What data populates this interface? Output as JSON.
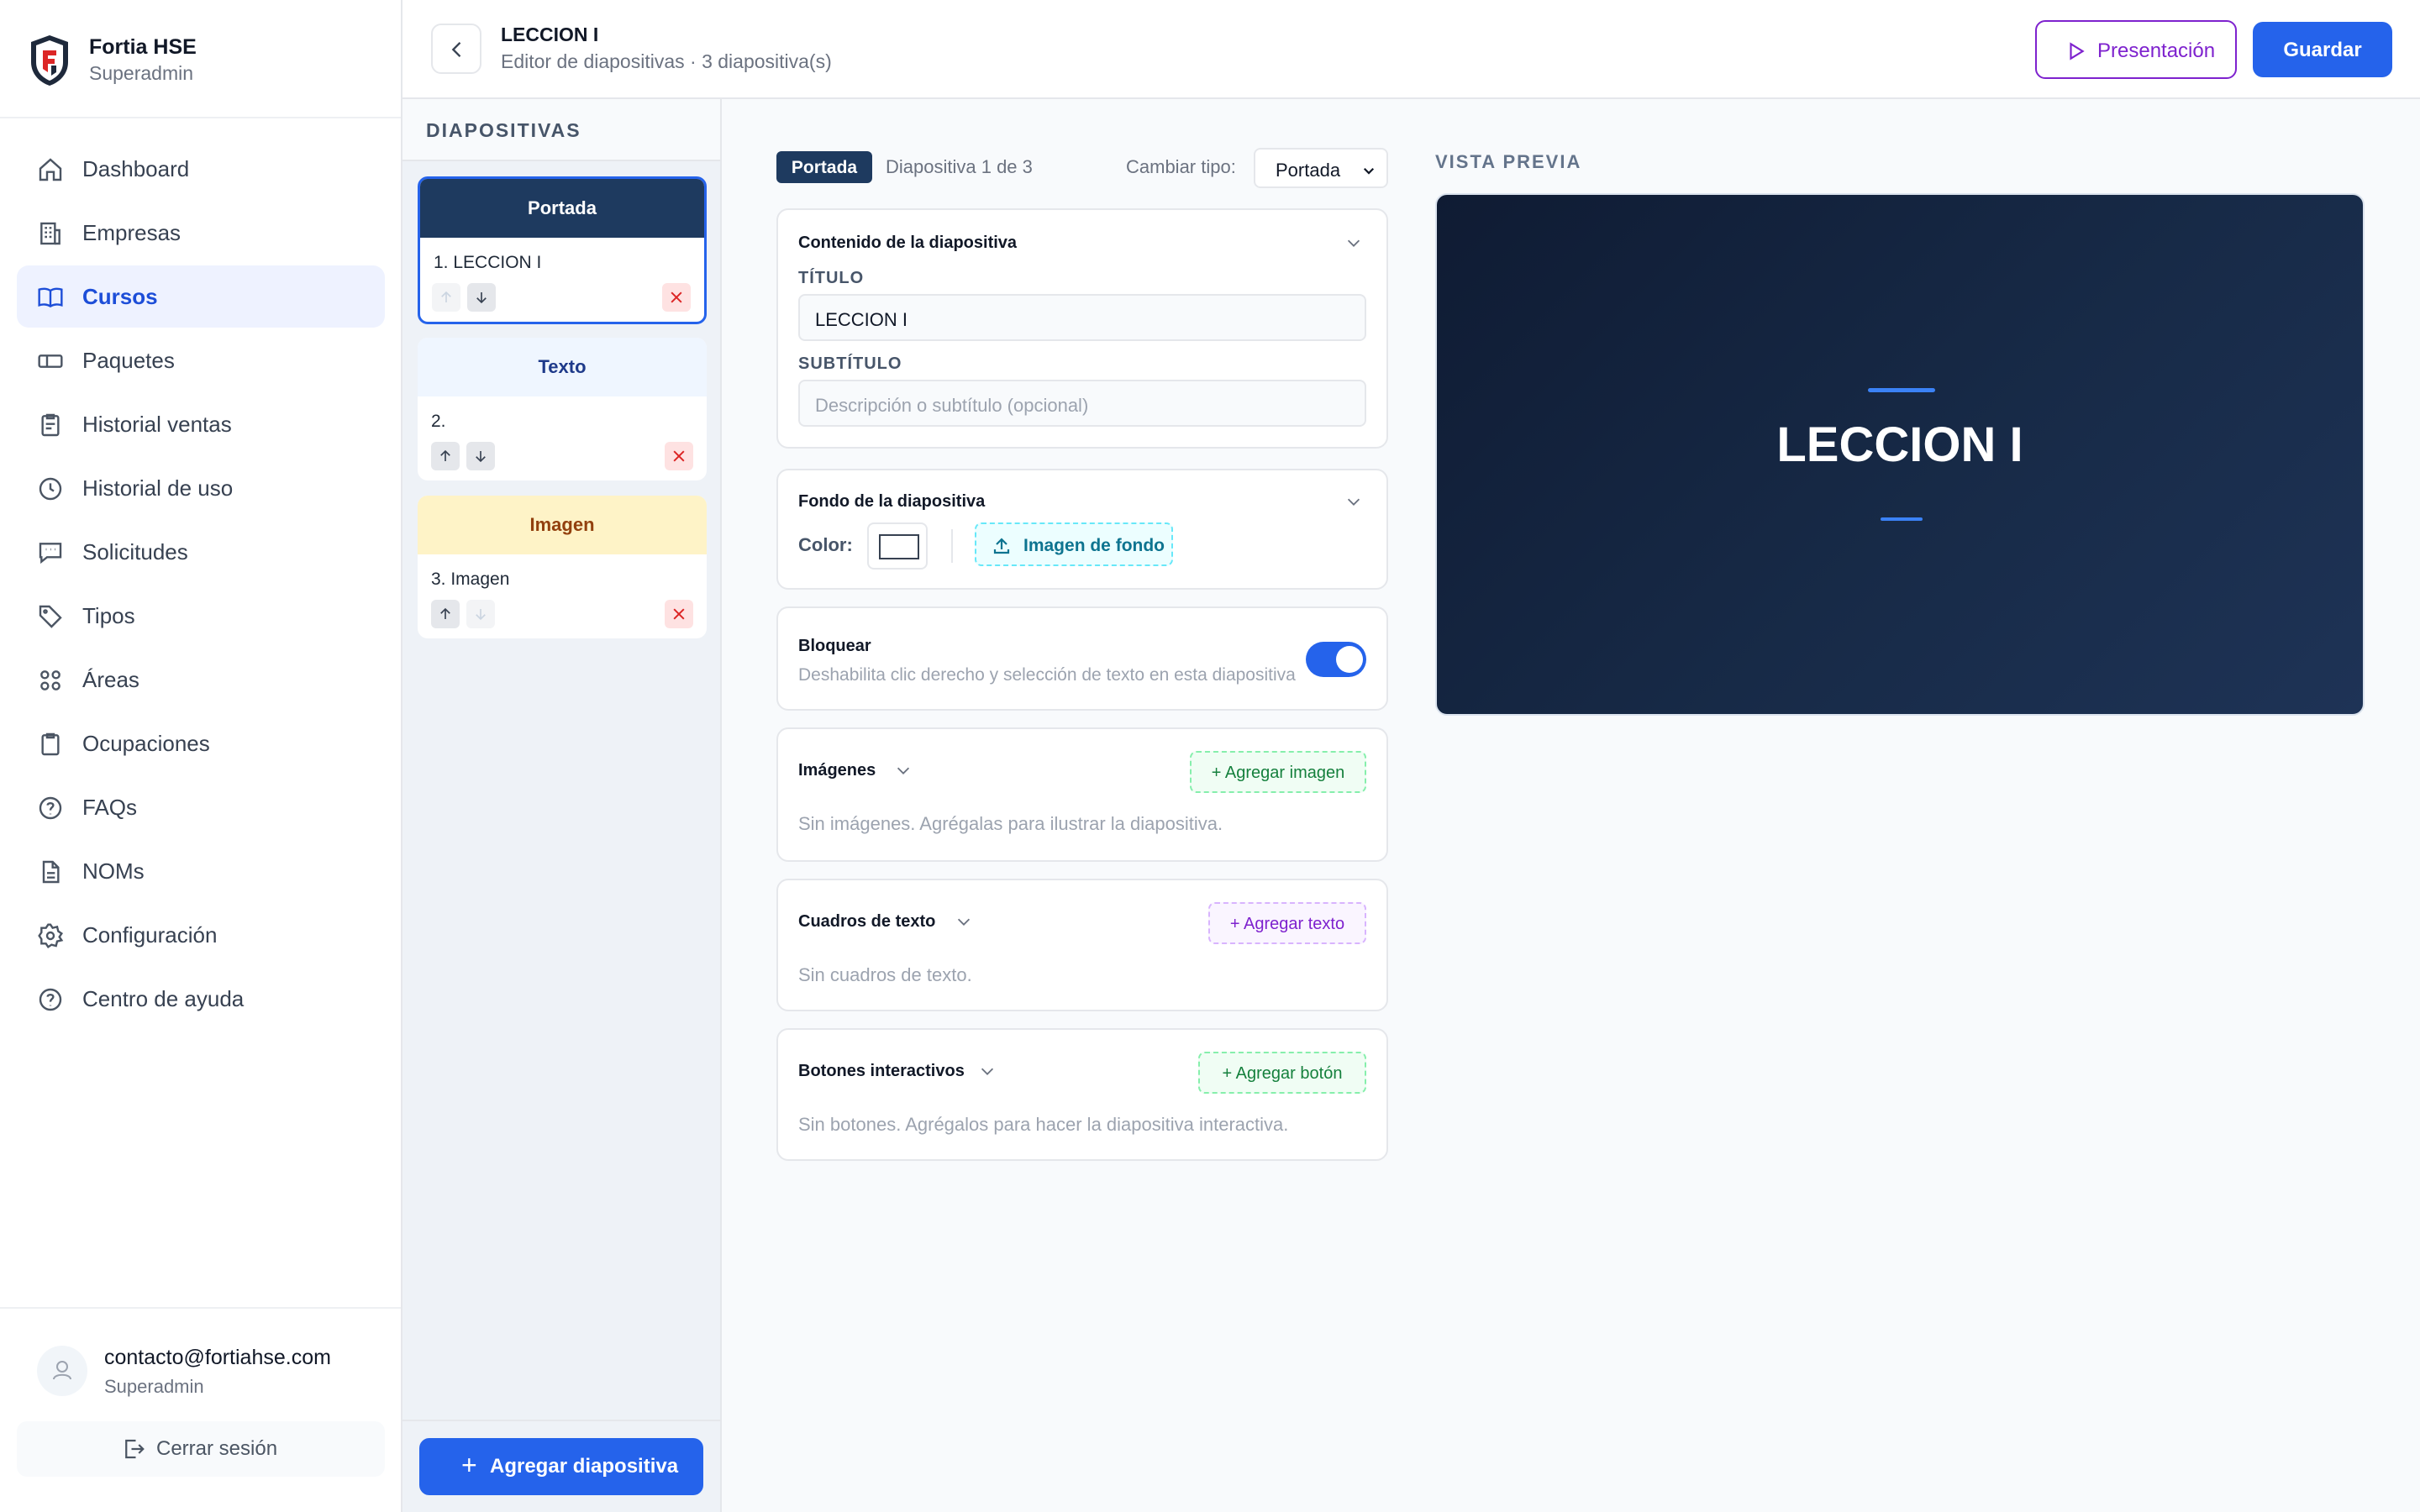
{
  "brand": {
    "name": "Fortia HSE",
    "role": "Superadmin"
  },
  "nav": [
    {
      "label": "Dashboard",
      "icon": "home-icon"
    },
    {
      "label": "Empresas",
      "icon": "building-icon"
    },
    {
      "label": "Cursos",
      "icon": "book-icon",
      "active": true
    },
    {
      "label": "Paquetes",
      "icon": "ticket-icon"
    },
    {
      "label": "Historial ventas",
      "icon": "receipt-icon"
    },
    {
      "label": "Historial de uso",
      "icon": "clock-icon"
    },
    {
      "label": "Solicitudes",
      "icon": "message-icon"
    },
    {
      "label": "Tipos",
      "icon": "tag-icon"
    },
    {
      "label": "Áreas",
      "icon": "grid-icon"
    },
    {
      "label": "Ocupaciones",
      "icon": "clipboard-icon"
    },
    {
      "label": "FAQs",
      "icon": "help-circle-icon"
    },
    {
      "label": "NOMs",
      "icon": "document-icon"
    },
    {
      "label": "Configuración",
      "icon": "gear-icon"
    },
    {
      "label": "Centro de ayuda",
      "icon": "help-circle-icon"
    }
  ],
  "user": {
    "email": "contacto@fortiahse.com",
    "role": "Superadmin",
    "logout": "Cerrar sesión"
  },
  "header": {
    "title": "LECCION I",
    "subtitle": "Editor de diapositivas · 3 diapositiva(s)",
    "present_label": "Presentación",
    "save_label": "Guardar"
  },
  "slides_panel": {
    "title": "DIAPOSITIVAS",
    "add_label": "Agregar diapositiva",
    "items": [
      {
        "type": "Portada",
        "name": "1. LECCION I",
        "band_bg": "#1e3a5f",
        "band_fg": "#ffffff",
        "selected": true
      },
      {
        "type": "Texto",
        "name": "2.",
        "band_bg": "#eff6ff",
        "band_fg": "#1e3a8a",
        "selected": false
      },
      {
        "type": "Imagen",
        "name": "3. Imagen",
        "band_bg": "#fef3c7",
        "band_fg": "#92400e",
        "selected": false
      }
    ]
  },
  "editor": {
    "type_tag": "Portada",
    "slide_count": "Diapositiva 1 de 3",
    "change_type_label": "Cambiar tipo:",
    "type_value": "Portada",
    "content": {
      "title": "Contenido de la diapositiva",
      "title_label": "TÍTULO",
      "title_value": "LECCION I",
      "subtitle_label": "SUBTÍTULO",
      "subtitle_placeholder": "Descripción o subtítulo (opcional)"
    },
    "background": {
      "title": "Fondo de la diapositiva",
      "color_label": "Color:",
      "image_button": "Imagen de fondo"
    },
    "lock": {
      "title": "Bloquear",
      "description": "Deshabilita clic derecho y selección de texto en esta diapositiva",
      "enabled": true
    },
    "images": {
      "title": "Imágenes",
      "add": "+ Agregar imagen",
      "empty": "Sin imágenes. Agrégalas para ilustrar la diapositiva."
    },
    "textboxes": {
      "title": "Cuadros de texto",
      "add": "+ Agregar texto",
      "empty": "Sin cuadros de texto."
    },
    "buttons": {
      "title": "Botones interactivos",
      "add": "+ Agregar botón",
      "empty": "Sin botones. Agrégalos para hacer la diapositiva interactiva."
    }
  },
  "preview": {
    "label": "VISTA PREVIA",
    "title": "LECCION I"
  },
  "colors": {
    "primary": "#2563eb",
    "purple": "#7e22ce",
    "navy": "#1e3a5f",
    "green": "#15803d",
    "cyan": "#0e7490"
  }
}
